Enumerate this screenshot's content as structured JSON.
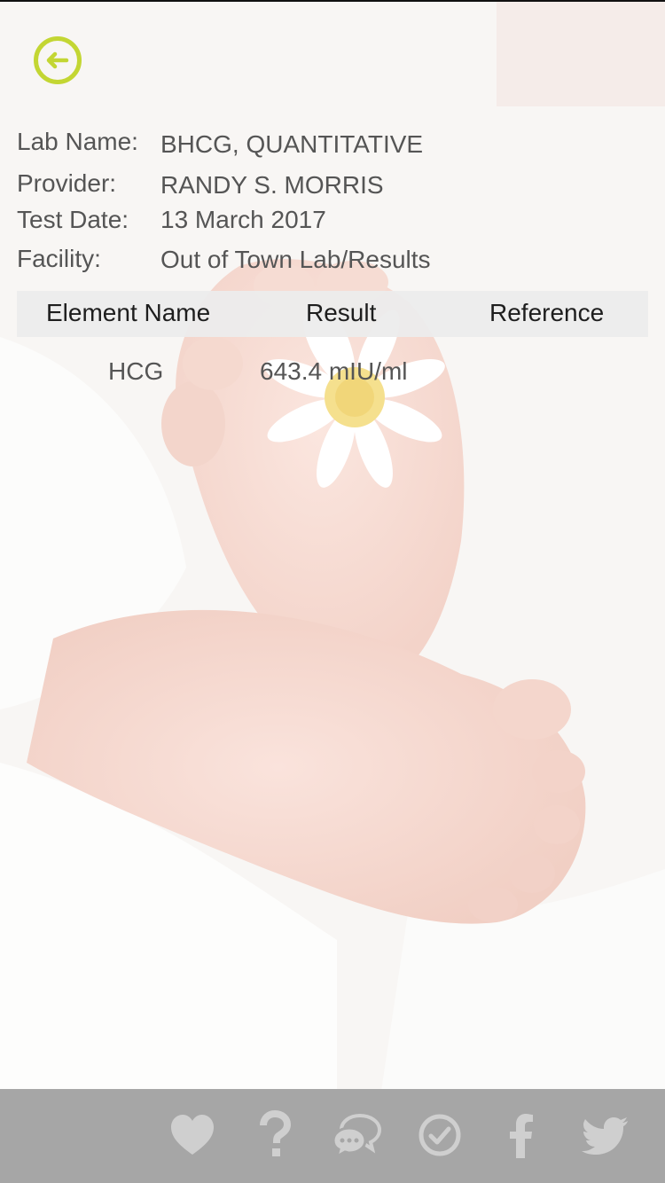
{
  "header": {
    "back_icon": "arrow-left-circle-icon",
    "accent_color": "#c3d633"
  },
  "lab_info": {
    "lab_name_label": "Lab Name:",
    "lab_name": "BHCG, QUANTITATIVE",
    "provider_label": "Provider:",
    "provider": "RANDY S. MORRIS",
    "test_date_label": "Test Date:",
    "test_date": "13 March 2017",
    "facility_label": "Facility:",
    "facility": "Out of Town Lab/Results"
  },
  "results_table": {
    "columns": [
      "Element Name",
      "Result",
      "Reference"
    ],
    "rows": [
      {
        "element": "HCG",
        "result": "643.4 mIU/ml",
        "reference": ""
      }
    ]
  },
  "footer": {
    "background_color": "#a6a6a6",
    "icons": [
      "heart-icon",
      "question-icon",
      "chat-icon",
      "checkmark-circle-icon",
      "facebook-icon",
      "twitter-icon"
    ]
  }
}
